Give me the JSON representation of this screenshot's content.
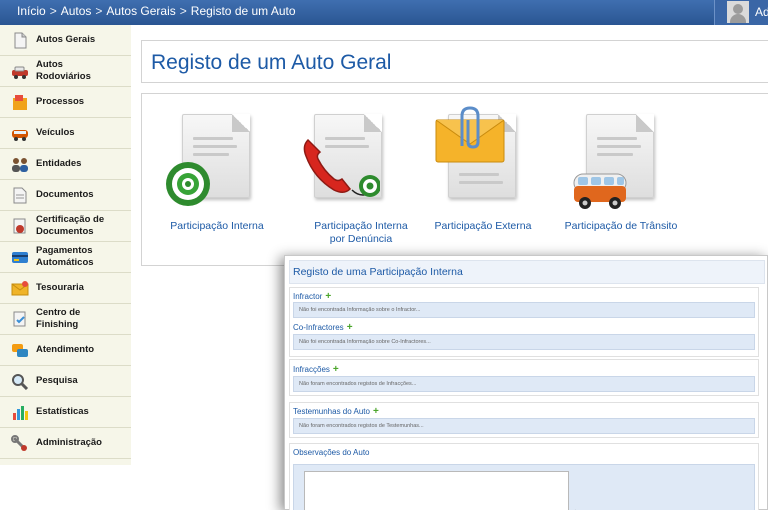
{
  "breadcrumb": [
    "Início",
    "Autos",
    "Autos Gerais",
    "Registo de um Auto"
  ],
  "breadcrumb_separator": ">",
  "user": {
    "name_fragment": "Ad"
  },
  "sidebar": {
    "items": [
      {
        "label": "Autos Gerais",
        "icon": "document-icon"
      },
      {
        "label": "Autos\nRodoviários",
        "icon": "car-accident-icon"
      },
      {
        "label": "Processos",
        "icon": "process-folder-icon"
      },
      {
        "label": "Veículos",
        "icon": "vehicle-icon"
      },
      {
        "label": "Entidades",
        "icon": "people-icon"
      },
      {
        "label": "Documentos",
        "icon": "documents-icon"
      },
      {
        "label": "Certificação de\nDocumentos",
        "icon": "certificate-seal-icon"
      },
      {
        "label": "Pagamentos\nAutomáticos",
        "icon": "credit-card-icon"
      },
      {
        "label": "Tesouraria",
        "icon": "treasury-envelope-icon"
      },
      {
        "label": "Centro de\nFinishing",
        "icon": "finishing-center-icon"
      },
      {
        "label": "Atendimento",
        "icon": "chat-bubbles-icon"
      },
      {
        "label": "Pesquisa",
        "icon": "magnifier-icon"
      },
      {
        "label": "Estatísticas",
        "icon": "bar-chart-icon"
      },
      {
        "label": "Administração",
        "icon": "admin-tools-icon"
      }
    ]
  },
  "page_title": "Registo de um Auto Geral",
  "options": [
    {
      "label": "Participação Interna",
      "icon": "target-document-icon"
    },
    {
      "label": "Participação Interna\npor Denúncia",
      "icon": "phone-document-icon"
    },
    {
      "label": "Participação Externa",
      "icon": "envelope-document-icon"
    },
    {
      "label": "Participação de Trânsito",
      "icon": "van-document-icon"
    }
  ],
  "dialog": {
    "title": "Registo de uma Participação Interna",
    "sections": {
      "infractor": {
        "label": "Infractor",
        "info": "Não foi encontrada Informação sobre o Infractor..."
      },
      "coinfractores": {
        "label": "Co-Infractores",
        "info": "Não foi encontrada Informação sobre Co-Infractores..."
      },
      "infracoes": {
        "label": "Infracções",
        "info": "Não foram encontrados registos de Infracções..."
      },
      "testemunhas": {
        "label": "Testemunhas do Auto",
        "info": "Não foram encontrados registos de Testemunhas..."
      },
      "observacoes": {
        "label": "Observações do Auto"
      }
    },
    "add_symbol": "+"
  },
  "colors": {
    "topbar": "#2f5c9c",
    "sidebar_bg": "#f6f6e9",
    "title_blue": "#1d5aa6",
    "add_green": "#4aa52a",
    "info_bg": "#dfe9f6"
  }
}
